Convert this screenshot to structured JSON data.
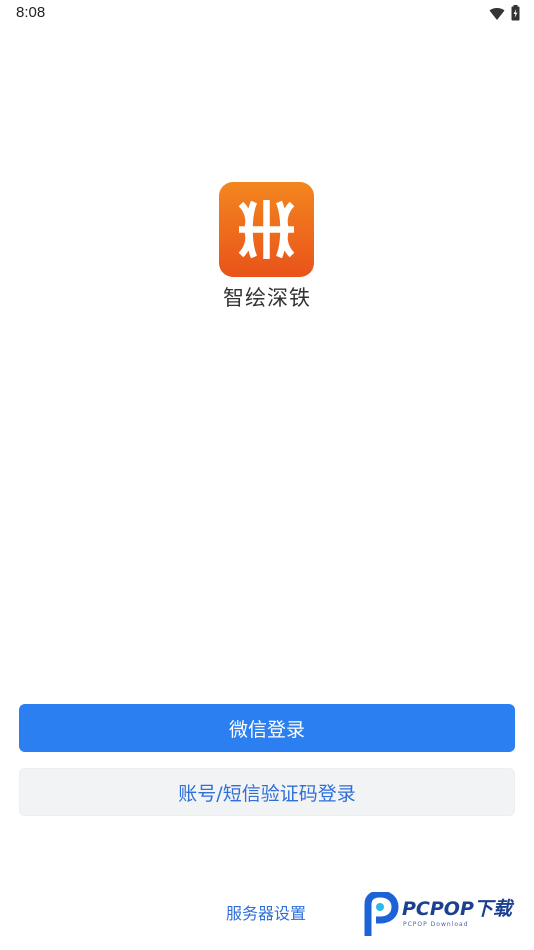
{
  "status_bar": {
    "time": "8:08",
    "icons": [
      "wifi-icon",
      "battery-icon"
    ]
  },
  "app": {
    "name": "智绘深铁",
    "logo_icon": "metro-logo-icon",
    "colors": {
      "logo_top": "#f3861f",
      "logo_bottom": "#e9531a"
    }
  },
  "buttons": {
    "wechat_login": "微信登录",
    "account_sms_login": "账号/短信验证码登录"
  },
  "footer": {
    "server_settings": "服务器设置"
  },
  "watermark": {
    "brand": "PCPOP下载",
    "sub": "PCPOP Download"
  },
  "colors": {
    "primary": "#2b7ff0",
    "link": "#2f6fd8",
    "secondary_bg": "#f2f3f4"
  }
}
